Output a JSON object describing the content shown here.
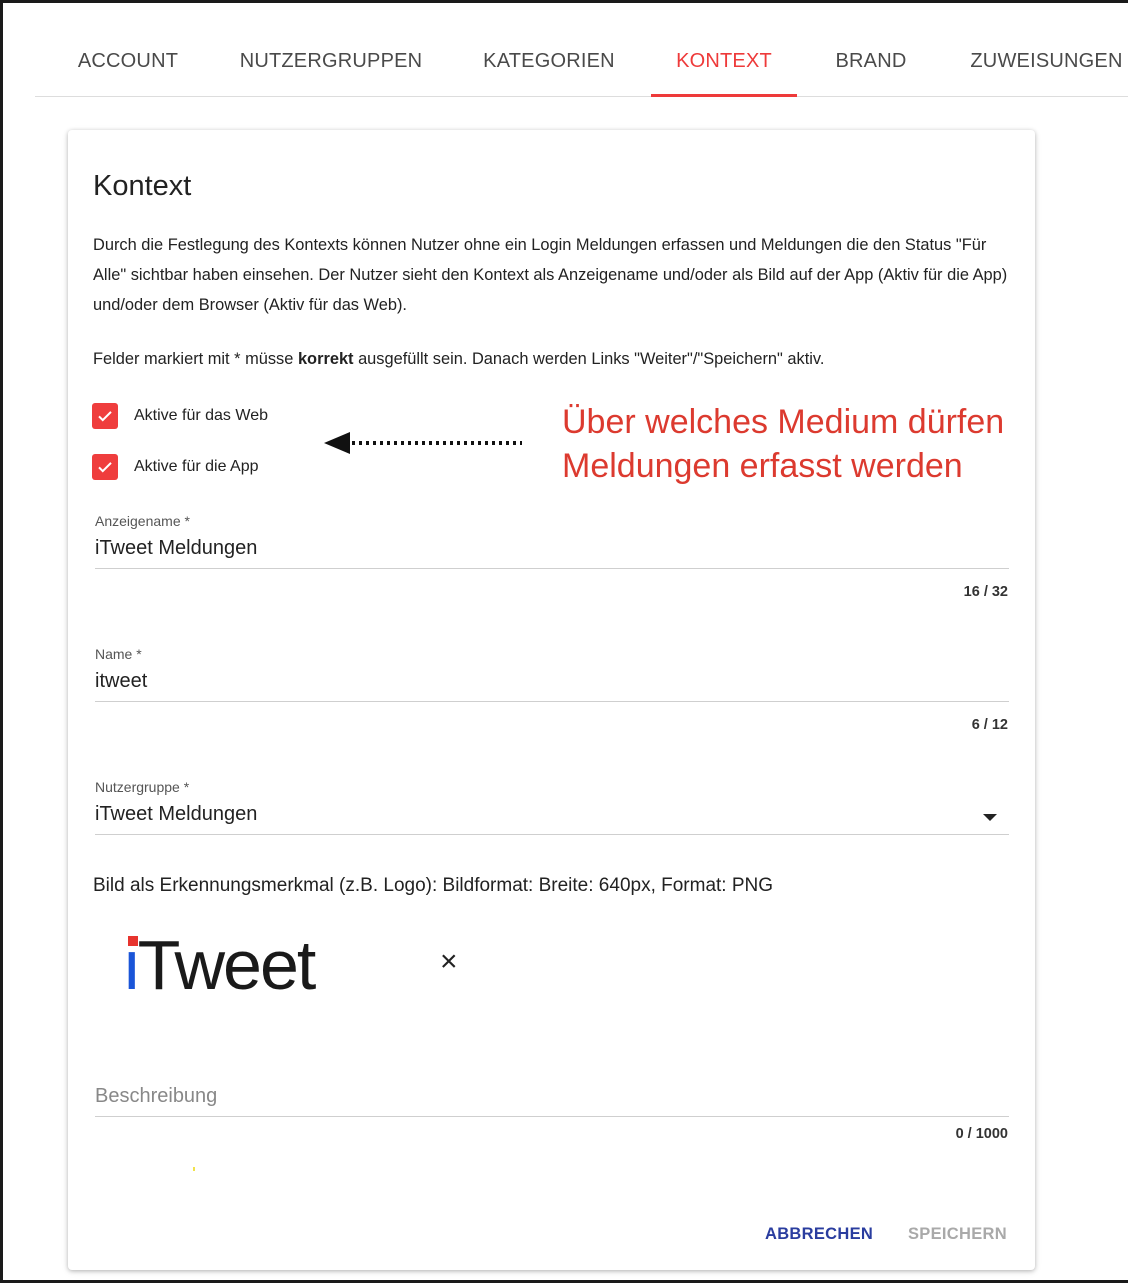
{
  "tabs": [
    {
      "label": "ACCOUNT",
      "active": false
    },
    {
      "label": "NUTZERGRUPPEN",
      "active": false
    },
    {
      "label": "KATEGORIEN",
      "active": false
    },
    {
      "label": "KONTEXT",
      "active": true
    },
    {
      "label": "BRAND",
      "active": false
    },
    {
      "label": "ZUWEISUNGEN",
      "active": false
    }
  ],
  "card": {
    "title": "Kontext",
    "description": "Durch die Festlegung des Kontexts können Nutzer ohne ein Login Meldungen erfassen und Meldungen die den Status \"Für Alle\" sichtbar haben einsehen. Der Nutzer sieht den Kontext als Anzeigename und/oder als Bild auf der App (Aktiv für die App) und/oder dem Browser (Aktiv für das Web).",
    "required_note": {
      "before": "Felder markiert mit * müsse ",
      "bold": "korrekt",
      "after": " ausgefüllt sein. Danach werden Links \"Weiter\"/\"Speichern\" aktiv."
    },
    "checkboxes": [
      {
        "label": "Aktive für das Web",
        "checked": true
      },
      {
        "label": "Aktive für die App",
        "checked": true
      }
    ],
    "fields": {
      "display_name": {
        "label": "Anzeigename *",
        "value": "iTweet Meldungen",
        "counter": "16 / 32"
      },
      "name": {
        "label": "Name *",
        "value": "itweet",
        "counter": "6 / 12"
      },
      "user_group": {
        "label": "Nutzergruppe *",
        "value": "iTweet Meldungen"
      },
      "description": {
        "placeholder": "Beschreibung",
        "counter": "0 / 1000"
      }
    },
    "image_hint": "Bild als Erkennungsmerkmal (z.B. Logo): Bildformat: Breite: 640px, Format: PNG",
    "logo": {
      "text_i": "i",
      "text_rest": "Tweet"
    },
    "remove_glyph": "×",
    "buttons": {
      "cancel": "ABBRECHEN",
      "save": "SPEICHERN"
    }
  },
  "annotation": {
    "line1": "Über welches Medium dürfen",
    "line2": "Meldungen erfasst werden"
  },
  "colors": {
    "accent": "#ee3a3a",
    "checkbox": "#ef3d3d",
    "cancel_button": "#2a3d9f",
    "disabled_button": "#a9a9a9",
    "annotation": "#dc3a2f"
  }
}
